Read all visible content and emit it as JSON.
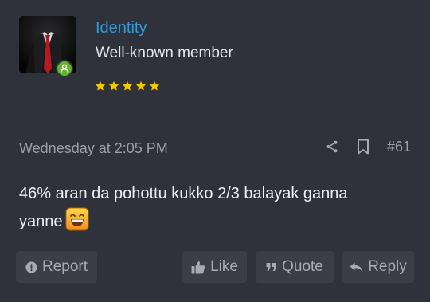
{
  "user": {
    "name": "Identity",
    "title": "Well-known member",
    "online": true,
    "rating": 5
  },
  "post": {
    "date": "Wednesday at 2:05 PM",
    "number": "#61",
    "message": "46% aran da pohottu kukko 2/3 balayak ganna yanne",
    "emoji_icon": "grinning-face-icon"
  },
  "actions": {
    "report": "Report",
    "like": "Like",
    "quote": "Quote",
    "reply": "Reply"
  },
  "icons": {
    "share": "share-icon",
    "bookmark": "bookmark-icon",
    "report": "alert-circle-icon",
    "like": "thumbs-up-icon",
    "quote": "quote-icon",
    "reply": "reply-arrow-icon"
  },
  "colors": {
    "background": "#2f323b",
    "username": "#2f9bdc",
    "online": "#63b32e",
    "star": "#f5c800",
    "button_bg": "#3b3e47"
  }
}
